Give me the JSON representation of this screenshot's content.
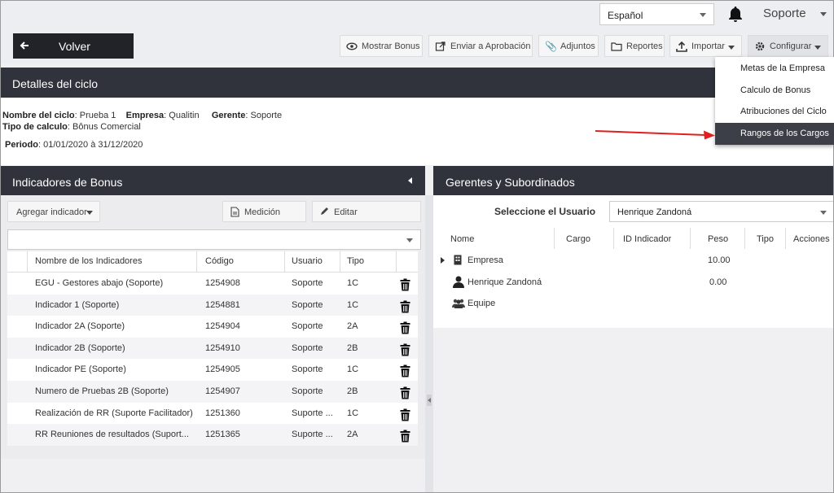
{
  "header": {
    "language": "Español",
    "user": "Soporte",
    "back_label": "Volver"
  },
  "toolbar": {
    "buttons": [
      {
        "label": "Mostrar Bonus",
        "icon": "eye-icon"
      },
      {
        "label": "Enviar a Aprobación",
        "icon": "send-icon"
      },
      {
        "label": "Adjuntos",
        "icon": "paperclip-icon"
      },
      {
        "label": "Reportes",
        "icon": "folder-icon"
      },
      {
        "label": "Importar",
        "icon": "upload-icon"
      },
      {
        "label": "Configurar",
        "icon": "gear-icon"
      }
    ]
  },
  "config_menu": {
    "items": [
      "Metas de la Empresa",
      "Calculo de Bonus",
      "Atribuciones del Ciclo",
      "Rangos de los Cargos"
    ],
    "active_index": 3
  },
  "cycle": {
    "title": "Detalles del ciclo",
    "name_label": "Nombre del ciclo",
    "name_value": "Prueba 1",
    "company_label": "Empresa",
    "company_value": "Qualitin",
    "manager_label": "Gerente",
    "manager_value": "Soporte",
    "calc_label": "Tipo de calculo",
    "calc_value": "Bônus Comercial",
    "period_label": "Periodo",
    "period_value": "01/01/2020 à 31/12/2020"
  },
  "indicators": {
    "title": "Indicadores de Bonus",
    "add_label": "Agregar indicador",
    "measure_label": "Medición",
    "edit_label": "Editar",
    "columns": [
      "Nombre de los Indicadores",
      "Código",
      "Usuario",
      "Tipo"
    ],
    "rows": [
      {
        "name": "EGU - Gestores abajo (Soporte)",
        "code": "1254908",
        "user": "Soporte",
        "type": "1C"
      },
      {
        "name": "Indicador 1 (Soporte)",
        "code": "1254881",
        "user": "Soporte",
        "type": "1C"
      },
      {
        "name": "Indicador 2A (Soporte)",
        "code": "1254904",
        "user": "Soporte",
        "type": "2A"
      },
      {
        "name": "Indicador 2B (Soporte)",
        "code": "1254910",
        "user": "Soporte",
        "type": "2B"
      },
      {
        "name": "Indicador PE (Soporte)",
        "code": "1254905",
        "user": "Soporte",
        "type": "1C"
      },
      {
        "name": "Numero de Pruebas 2B (Soporte)",
        "code": "1254907",
        "user": "Soporte",
        "type": "2B"
      },
      {
        "name": "Realización de RR (Suporte Facilitador)",
        "code": "1251360",
        "user": "Suporte ...",
        "type": "1C"
      },
      {
        "name": "RR Reuniones de resultados (Suport...",
        "code": "1251365",
        "user": "Suporte ...",
        "type": "2A"
      }
    ]
  },
  "managers": {
    "title": "Gerentes y Subordinados",
    "select_label": "Seleccione el Usuario",
    "selected_user": "Henrique Zandoná",
    "columns": [
      "Nome",
      "Cargo",
      "ID Indicador",
      "Peso",
      "Tipo",
      "Acciones"
    ],
    "rows": [
      {
        "name": "Empresa",
        "weight": "10.00",
        "icon": "building-icon"
      },
      {
        "name": "Henrique Zandoná",
        "weight": "0.00",
        "icon": "person-icon"
      },
      {
        "name": "Equipe",
        "weight": "",
        "icon": "team-icon"
      }
    ]
  },
  "colors": {
    "header_dark": "#30333c",
    "back_button": "#212329",
    "menu_active": "#3d3f48",
    "annotation_arrow": "#e0201e",
    "page_bg": "#f0f0f2"
  }
}
